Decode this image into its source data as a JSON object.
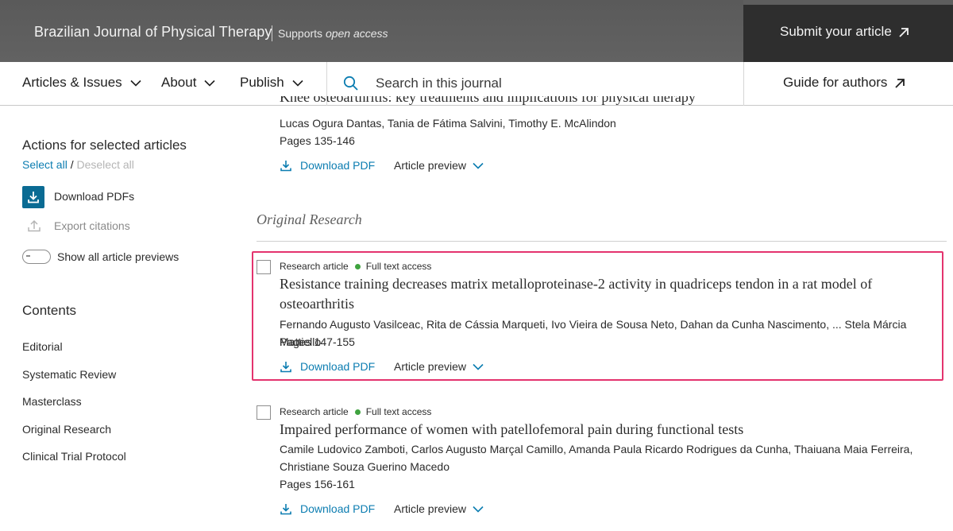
{
  "header": {
    "journal_title": "Brazilian Journal of Physical Therapy",
    "oa_prefix": "Supports ",
    "oa_emphasis": "open access",
    "submit_label": "Submit your article"
  },
  "nav": {
    "items": [
      {
        "label": "Articles & Issues"
      },
      {
        "label": "About"
      },
      {
        "label": "Publish"
      }
    ],
    "search_placeholder": "Search in this journal",
    "guide_label": "Guide for authors"
  },
  "sidebar": {
    "actions_heading": "Actions for selected articles",
    "select_all": "Select all",
    "separator": "/",
    "deselect_all": "Deselect all",
    "download_pdfs": "Download PDFs",
    "export_citations": "Export citations",
    "show_previews": "Show all article previews",
    "contents_heading": "Contents",
    "contents": [
      "Editorial",
      "Systematic Review",
      "Masterclass",
      "Original Research",
      "Clinical Trial Protocol"
    ]
  },
  "main": {
    "partial_article": {
      "title": "Knee osteoarthritis: key treatments and implications for physical therapy",
      "authors": "Lucas Ogura Dantas, Tania de Fátima Salvini, Timothy E. McAlindon",
      "pages": "Pages 135-146",
      "download": "Download PDF",
      "preview": "Article preview"
    },
    "section_heading": "Original Research",
    "articles": [
      {
        "type": "Research article",
        "access": "Full text access",
        "title": "Resistance training decreases matrix metalloproteinase-2 activity in quadriceps tendon in a rat model of osteoarthritis",
        "authors": "Fernando Augusto Vasilceac, Rita de Cássia Marqueti, Ivo Vieira de Sousa Neto, Dahan da Cunha Nascimento, ... Stela Márcia Mattiello",
        "pages": "Pages 147-155",
        "download": "Download PDF",
        "preview": "Article preview"
      },
      {
        "type": "Research article",
        "access": "Full text access",
        "title": "Impaired performance of women with patellofemoral pain during functional tests",
        "authors": "Camile Ludovico Zamboti, Carlos Augusto Marçal Camillo, Amanda Paula Ricardo Rodrigues da Cunha, Thaiuana Maia Ferreira, Christiane Souza Guerino Macedo",
        "pages": "Pages 156-161",
        "download": "Download PDF",
        "preview": "Article preview"
      }
    ]
  },
  "colors": {
    "link": "#0c7db1",
    "highlight": "#e4336e",
    "access_dot": "#3fa33f"
  }
}
